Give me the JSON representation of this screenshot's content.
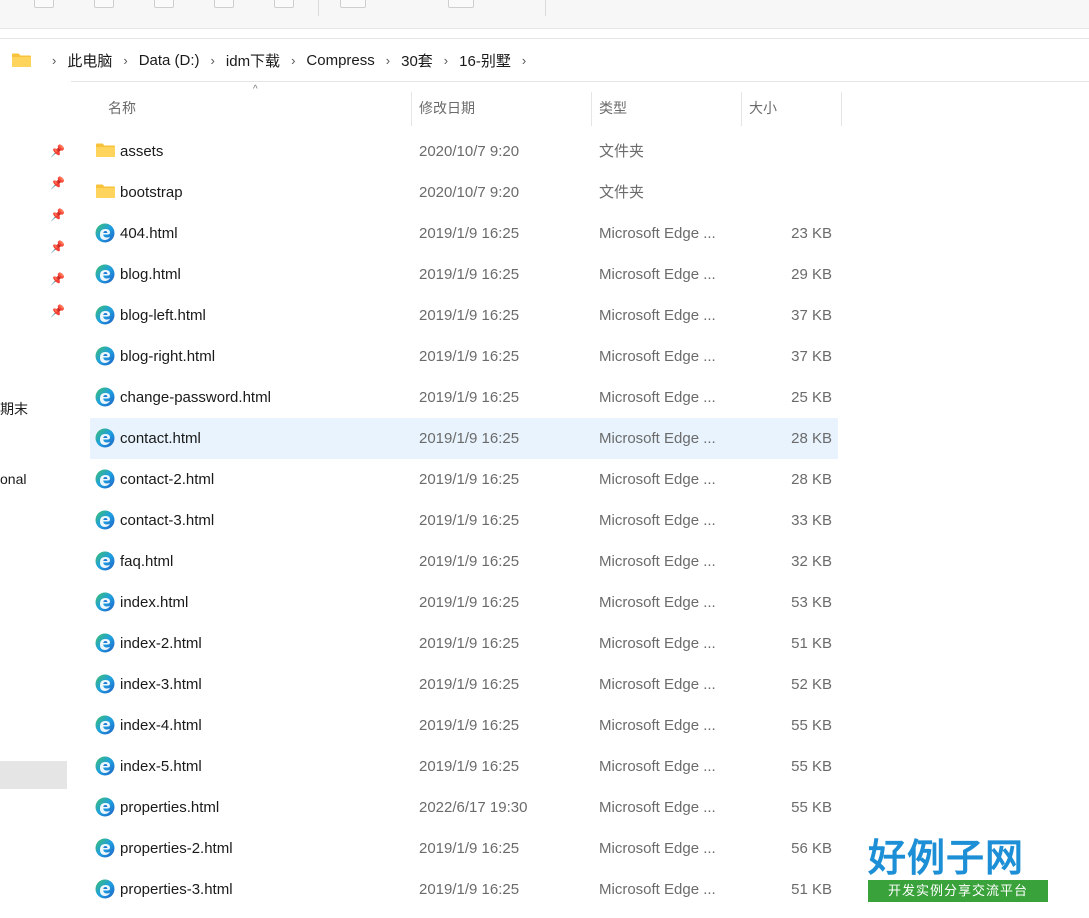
{
  "breadcrumb": [
    "此电脑",
    "Data (D:)",
    "idm下载",
    "Compress",
    "30套",
    "16-别墅"
  ],
  "nav": {
    "partial_items": [
      "期末",
      "onal"
    ]
  },
  "columns": {
    "name": "名称",
    "date": "修改日期",
    "type": "类型",
    "size": "大小"
  },
  "files": [
    {
      "name": "assets",
      "date": "2020/10/7 9:20",
      "type": "文件夹",
      "size": "",
      "kind": "folder"
    },
    {
      "name": "bootstrap",
      "date": "2020/10/7 9:20",
      "type": "文件夹",
      "size": "",
      "kind": "folder"
    },
    {
      "name": "404.html",
      "date": "2019/1/9 16:25",
      "type": "Microsoft Edge ...",
      "size": "23 KB",
      "kind": "edge"
    },
    {
      "name": "blog.html",
      "date": "2019/1/9 16:25",
      "type": "Microsoft Edge ...",
      "size": "29 KB",
      "kind": "edge"
    },
    {
      "name": "blog-left.html",
      "date": "2019/1/9 16:25",
      "type": "Microsoft Edge ...",
      "size": "37 KB",
      "kind": "edge"
    },
    {
      "name": "blog-right.html",
      "date": "2019/1/9 16:25",
      "type": "Microsoft Edge ...",
      "size": "37 KB",
      "kind": "edge"
    },
    {
      "name": "change-password.html",
      "date": "2019/1/9 16:25",
      "type": "Microsoft Edge ...",
      "size": "25 KB",
      "kind": "edge"
    },
    {
      "name": "contact.html",
      "date": "2019/1/9 16:25",
      "type": "Microsoft Edge ...",
      "size": "28 KB",
      "kind": "edge",
      "selected": true
    },
    {
      "name": "contact-2.html",
      "date": "2019/1/9 16:25",
      "type": "Microsoft Edge ...",
      "size": "28 KB",
      "kind": "edge"
    },
    {
      "name": "contact-3.html",
      "date": "2019/1/9 16:25",
      "type": "Microsoft Edge ...",
      "size": "33 KB",
      "kind": "edge"
    },
    {
      "name": "faq.html",
      "date": "2019/1/9 16:25",
      "type": "Microsoft Edge ...",
      "size": "32 KB",
      "kind": "edge"
    },
    {
      "name": "index.html",
      "date": "2019/1/9 16:25",
      "type": "Microsoft Edge ...",
      "size": "53 KB",
      "kind": "edge"
    },
    {
      "name": "index-2.html",
      "date": "2019/1/9 16:25",
      "type": "Microsoft Edge ...",
      "size": "51 KB",
      "kind": "edge"
    },
    {
      "name": "index-3.html",
      "date": "2019/1/9 16:25",
      "type": "Microsoft Edge ...",
      "size": "52 KB",
      "kind": "edge"
    },
    {
      "name": "index-4.html",
      "date": "2019/1/9 16:25",
      "type": "Microsoft Edge ...",
      "size": "55 KB",
      "kind": "edge"
    },
    {
      "name": "index-5.html",
      "date": "2019/1/9 16:25",
      "type": "Microsoft Edge ...",
      "size": "55 KB",
      "kind": "edge"
    },
    {
      "name": "properties.html",
      "date": "2022/6/17 19:30",
      "type": "Microsoft Edge ...",
      "size": "55 KB",
      "kind": "edge"
    },
    {
      "name": "properties-2.html",
      "date": "2019/1/9 16:25",
      "type": "Microsoft Edge ...",
      "size": "56 KB",
      "kind": "edge"
    },
    {
      "name": "properties-3.html",
      "date": "2019/1/9 16:25",
      "type": "Microsoft Edge ...",
      "size": "51 KB",
      "kind": "edge"
    }
  ],
  "watermark": {
    "logo_text": "好例子网",
    "logo_sub": "开发实例分享交流平台"
  },
  "colors": {
    "selection": "#e8f3fd",
    "folder": "#f8c33a",
    "edge_blue": "#1f79d6",
    "edge_green": "#3fc06a",
    "watermark_blue": "#1c8fd6",
    "watermark_green": "#39a23a"
  }
}
